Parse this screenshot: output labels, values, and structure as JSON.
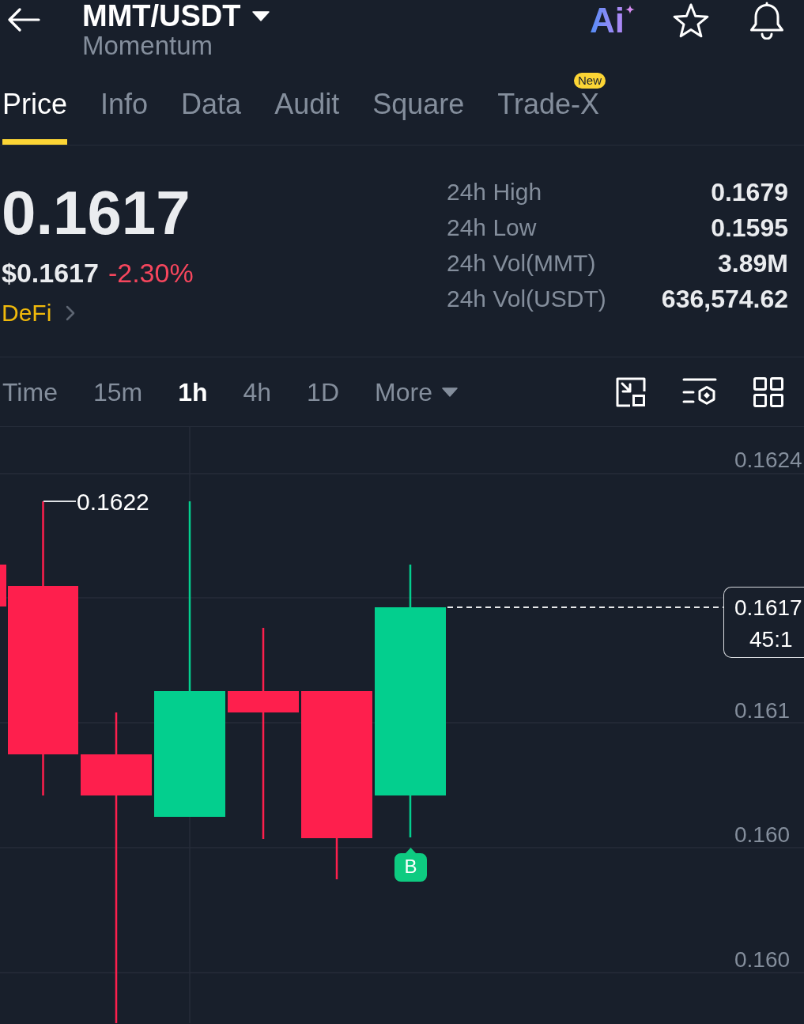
{
  "header": {
    "title": "MMT/USDT",
    "subtitle": "Momentum",
    "ai_label": "Ai"
  },
  "tabs": [
    {
      "label": "Price",
      "selected": true
    },
    {
      "label": "Info",
      "selected": false
    },
    {
      "label": "Data",
      "selected": false
    },
    {
      "label": "Audit",
      "selected": false
    },
    {
      "label": "Square",
      "selected": false
    },
    {
      "label": "Trade-X",
      "selected": false,
      "badge": "New"
    }
  ],
  "ticker": {
    "price": "0.1617",
    "usd_price": "$0.1617",
    "change": "-2.30%",
    "down": true,
    "category": "DeFi"
  },
  "stats": [
    {
      "label": "24h High",
      "value": "0.1679"
    },
    {
      "label": "24h Low",
      "value": "0.1595"
    },
    {
      "label": "24h Vol(MMT)",
      "value": "3.89M"
    },
    {
      "label": "24h Vol(USDT)",
      "value": "636,574.62"
    }
  ],
  "intervals": [
    {
      "label": "Time",
      "kind": "option",
      "selected": false
    },
    {
      "label": "15m",
      "kind": "option",
      "selected": false
    },
    {
      "label": "1h",
      "kind": "option",
      "selected": true
    },
    {
      "label": "4h",
      "kind": "option",
      "selected": false
    },
    {
      "label": "1D",
      "kind": "option",
      "selected": false
    },
    {
      "label": "More",
      "kind": "menu",
      "selected": false
    }
  ],
  "chart": {
    "price_axis_labels": [
      "0.1624",
      "0.161",
      "0.160",
      "0.160"
    ],
    "high_label": "0.1622",
    "last_price": {
      "price": "0.1617",
      "countdown": "45:1"
    },
    "trade_marker": {
      "label": "B",
      "buy": true
    }
  }
}
